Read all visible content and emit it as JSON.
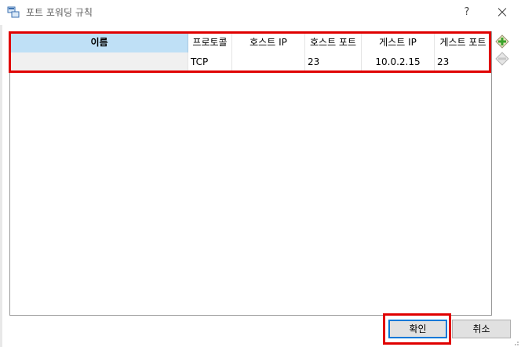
{
  "window": {
    "title": "포트 포워딩 규칙",
    "help_label": "?"
  },
  "table": {
    "columns": [
      "이름",
      "프로토콜",
      "호스트 IP",
      "호스트 포트",
      "게스트 IP",
      "게스트 포트"
    ],
    "rows": [
      {
        "name": "",
        "protocol": "TCP",
        "host_ip": "",
        "host_port": "23",
        "guest_ip": "10.0.2.15",
        "guest_port": "23"
      }
    ]
  },
  "side_buttons": {
    "add_icon": "add-rule-icon",
    "remove_icon": "remove-rule-icon"
  },
  "buttons": {
    "ok_label": "확인",
    "cancel_label": "취소"
  },
  "colors": {
    "selected_header": "#bfe0f6",
    "highlight": "#e00000",
    "default_button_border": "#0078d7",
    "add_icon_green": "#3aa32a"
  }
}
